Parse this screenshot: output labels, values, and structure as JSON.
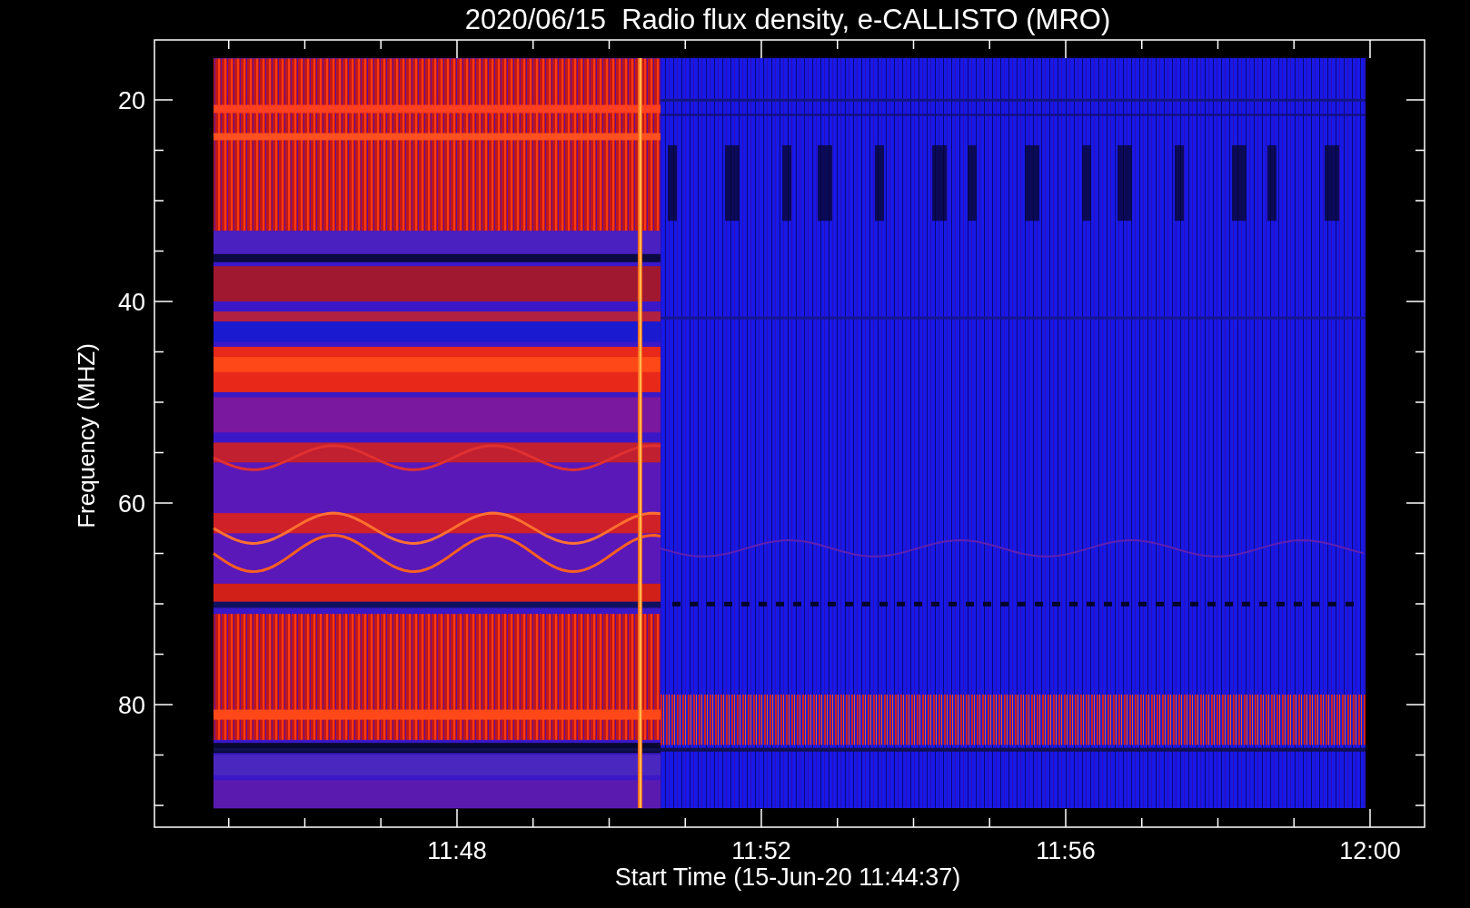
{
  "title": "2020/06/15  Radio flux density, e-CALLISTO (MRO)",
  "y_axis": {
    "label": "Frequency (MHZ)",
    "ticks": [
      "20",
      "40",
      "60",
      "80"
    ]
  },
  "x_axis": {
    "label": "Start Time (15-Jun-20 11:44:37)",
    "ticks": [
      "11:48",
      "11:52",
      "11:56",
      "12:00"
    ]
  }
}
